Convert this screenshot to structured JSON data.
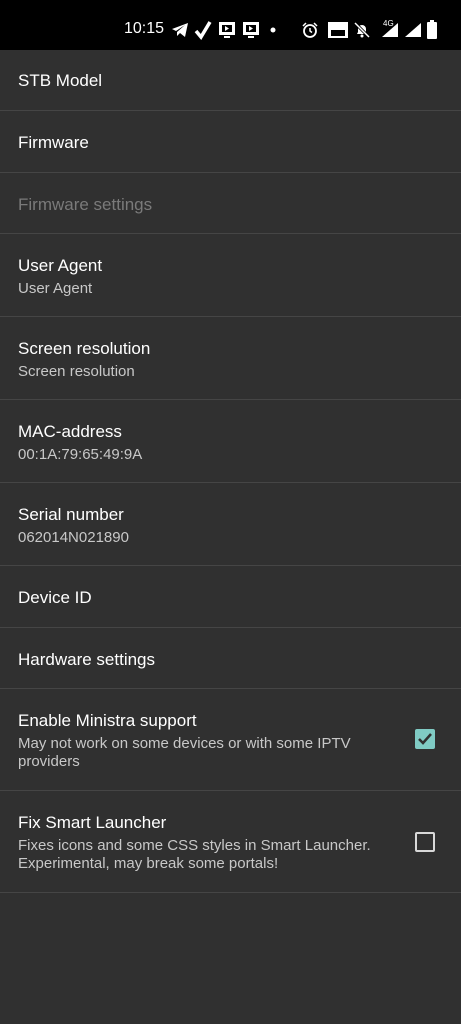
{
  "status_bar": {
    "time": "10:15",
    "icons": [
      "telegram-icon",
      "check-icon",
      "cast-icon",
      "cast-icon-2",
      "dot-icon",
      "alarm-icon",
      "volte-icon",
      "bell-off-icon",
      "signal-4g-icon",
      "signal-icon",
      "battery-icon"
    ],
    "network_label": "4G"
  },
  "settings": {
    "stb_model": {
      "title": "STB Model"
    },
    "firmware": {
      "title": "Firmware"
    },
    "firmware_settings": {
      "title": "Firmware settings"
    },
    "user_agent": {
      "title": "User Agent",
      "summary": "User Agent"
    },
    "screen_resolution": {
      "title": "Screen resolution",
      "summary": "Screen resolution"
    },
    "mac_address": {
      "title": "MAC-address",
      "summary": "00:1A:79:65:49:9A"
    },
    "serial_number": {
      "title": "Serial number",
      "summary": "062014N021890"
    },
    "device_id": {
      "title": "Device ID"
    },
    "hardware_settings": {
      "title": "Hardware settings"
    },
    "enable_ministra": {
      "title": "Enable Ministra support",
      "summary": "May not work on some devices or with some IPTV providers",
      "checked": true
    },
    "fix_smart_launcher": {
      "title": "Fix Smart Launcher",
      "summary": "Fixes icons and some CSS styles in Smart Launcher. Experimental, may break some portals!",
      "checked": false
    }
  },
  "colors": {
    "background": "#303030",
    "divider": "#454545",
    "accent": "#80cbc4",
    "disabled_text": "#7a7a7a"
  }
}
